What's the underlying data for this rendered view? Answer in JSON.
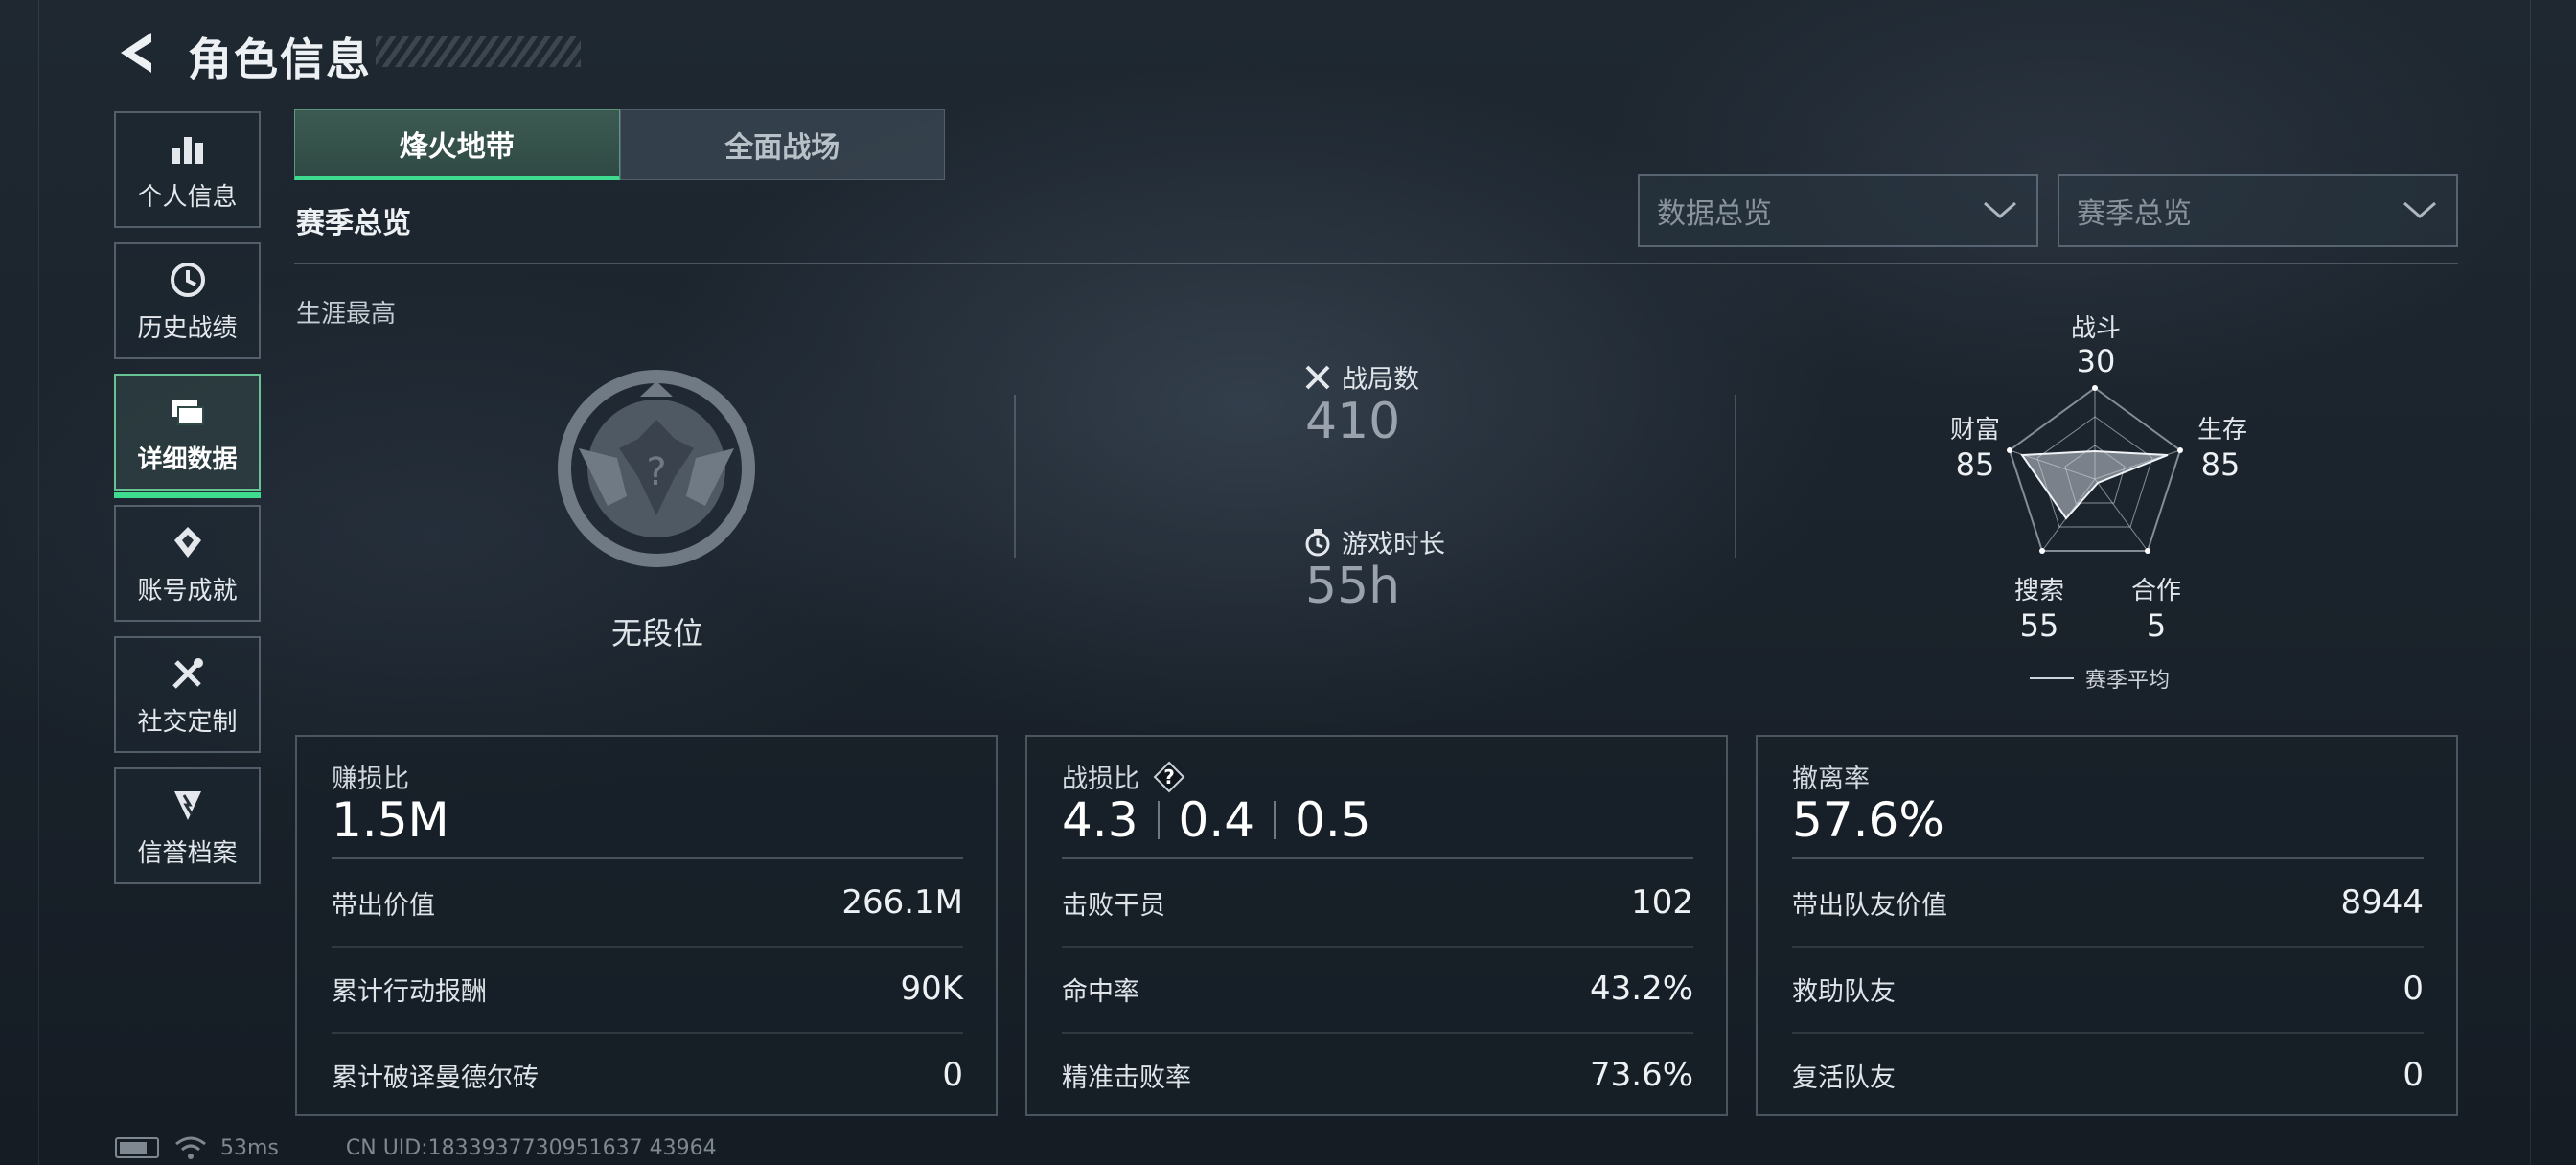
{
  "header": {
    "title": "角色信息"
  },
  "sidebar": {
    "items": [
      {
        "label": "个人信息",
        "icon": "bar-chart-icon",
        "active": false
      },
      {
        "label": "历史战绩",
        "icon": "history-clock-icon",
        "active": false
      },
      {
        "label": "详细数据",
        "icon": "data-cards-icon",
        "active": true
      },
      {
        "label": "账号成就",
        "icon": "achievement-icon",
        "active": false
      },
      {
        "label": "社交定制",
        "icon": "tools-icon",
        "active": false
      },
      {
        "label": "信誉档案",
        "icon": "credibility-shield-icon",
        "active": false
      }
    ]
  },
  "tabs": [
    {
      "label": "烽火地带",
      "active": true
    },
    {
      "label": "全面战场",
      "active": false
    }
  ],
  "section_title": "赛季总览",
  "filters": {
    "data_dropdown": "数据总览",
    "season_dropdown": "赛季总览"
  },
  "career": {
    "label": "生涯最高",
    "rank": "无段位"
  },
  "matches": {
    "label": "战局数",
    "value": "410"
  },
  "playtime": {
    "label": "游戏时长",
    "value": "55h"
  },
  "radar": {
    "legend": "赛季平均",
    "axes": [
      {
        "label": "战斗",
        "value": "30"
      },
      {
        "label": "生存",
        "value": "85"
      },
      {
        "label": "合作",
        "value": "5"
      },
      {
        "label": "搜索",
        "value": "55"
      },
      {
        "label": "财富",
        "value": "85"
      }
    ]
  },
  "cards": {
    "profit": {
      "title": "赚损比",
      "value": "1.5M",
      "rows": [
        {
          "k": "带出价值",
          "v": "266.1M"
        },
        {
          "k": "累计行动报酬",
          "v": "90K"
        },
        {
          "k": "累计破译曼德尔砖",
          "v": "0"
        }
      ]
    },
    "kd": {
      "title": "战损比",
      "values": [
        "4.3",
        "0.4",
        "0.5"
      ],
      "rows": [
        {
          "k": "击败干员",
          "v": "102"
        },
        {
          "k": "命中率",
          "v": "43.2%"
        },
        {
          "k": "精准击败率",
          "v": "73.6%"
        }
      ]
    },
    "extract": {
      "title": "撤离率",
      "value": "57.6%",
      "rows": [
        {
          "k": "带出队友价值",
          "v": "8944"
        },
        {
          "k": "救助队友",
          "v": "0"
        },
        {
          "k": "复活队友",
          "v": "0"
        }
      ]
    }
  },
  "footer": {
    "ping": "53ms",
    "uid": "CN UID:1833937730951637 43964"
  },
  "colors": {
    "accent": "#3ddc8e",
    "bg": "#1a222b"
  }
}
